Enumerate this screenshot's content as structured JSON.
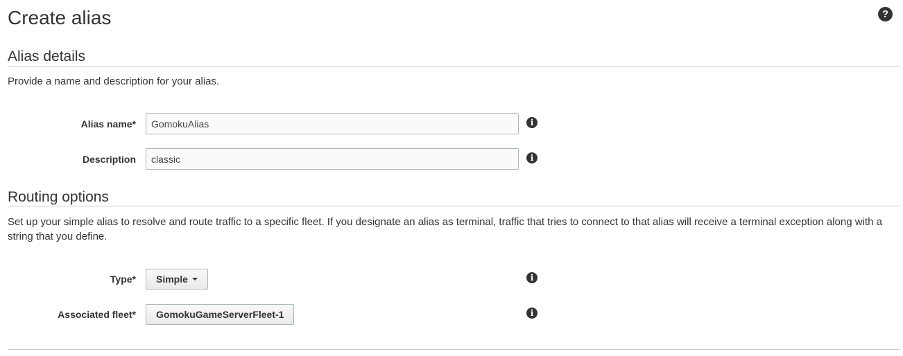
{
  "page": {
    "title": "Create alias",
    "help_icon": "question-circle-icon"
  },
  "alias_details": {
    "heading": "Alias details",
    "description": "Provide a name and description for your alias.",
    "alias_name": {
      "label": "Alias name*",
      "value": "GomokuAlias"
    },
    "description_field": {
      "label": "Description",
      "value": "classic"
    }
  },
  "routing_options": {
    "heading": "Routing options",
    "description": "Set up your simple alias to resolve and route traffic to a specific fleet. If you designate an alias as terminal, traffic that tries to connect to that alias will receive a terminal exception along with a string that you define.",
    "type": {
      "label": "Type*",
      "selected": "Simple"
    },
    "associated_fleet": {
      "label": "Associated fleet*",
      "selected": "GomokuGameServerFleet-1"
    }
  },
  "icons": {
    "info": "info-circle-icon",
    "help": "question-circle-icon"
  }
}
